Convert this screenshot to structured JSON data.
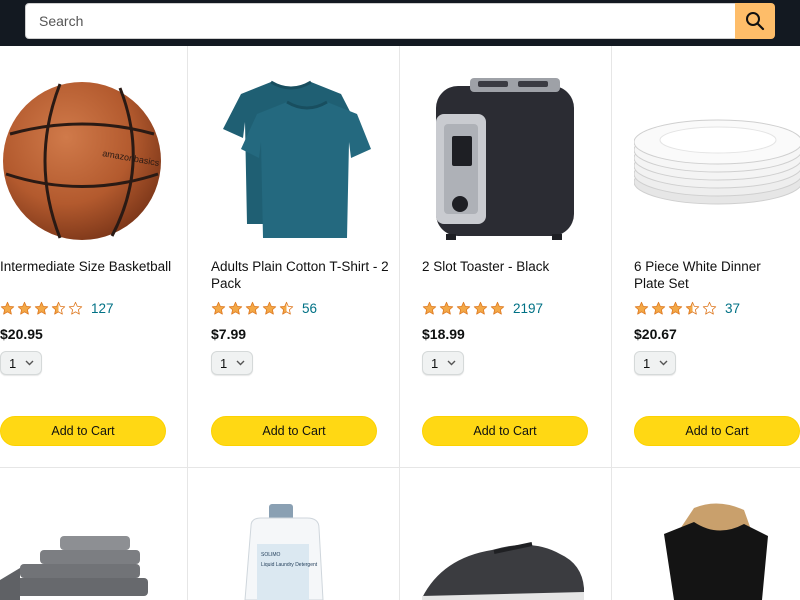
{
  "search": {
    "placeholder": "Search",
    "button_icon": "search-icon"
  },
  "colors": {
    "header_bg": "#131921",
    "search_button": "#febd69",
    "cart_button": "#ffd814",
    "star": "#f3a847",
    "link": "#007185"
  },
  "products": [
    {
      "title": "Intermediate Size Basketball",
      "rating": 3.5,
      "rating_count": "127",
      "price": "$20.95",
      "qty": "1",
      "cart_label": "Add to Cart",
      "image": "basketball-image"
    },
    {
      "title": "Adults Plain Cotton T-Shirt - 2 Pack",
      "rating": 4.5,
      "rating_count": "56",
      "price": "$7.99",
      "qty": "1",
      "cart_label": "Add to Cart",
      "image": "tshirt-image"
    },
    {
      "title": "2 Slot Toaster - Black",
      "rating": 5,
      "rating_count": "2197",
      "price": "$18.99",
      "qty": "1",
      "cart_label": "Add to Cart",
      "image": "toaster-image"
    },
    {
      "title": "6 Piece White Dinner Plate Set",
      "rating": 3.5,
      "rating_count": "37",
      "price": "$20.67",
      "qty": "1",
      "cart_label": "Add to Cart",
      "image": "plates-image"
    }
  ],
  "row2_images": [
    "towels-image",
    "detergent-image",
    "sneaker-image",
    "black-top-image"
  ],
  "detergent_label": {
    "brand": "SOLIMO",
    "text": "Liquid Laundry Detergent"
  }
}
